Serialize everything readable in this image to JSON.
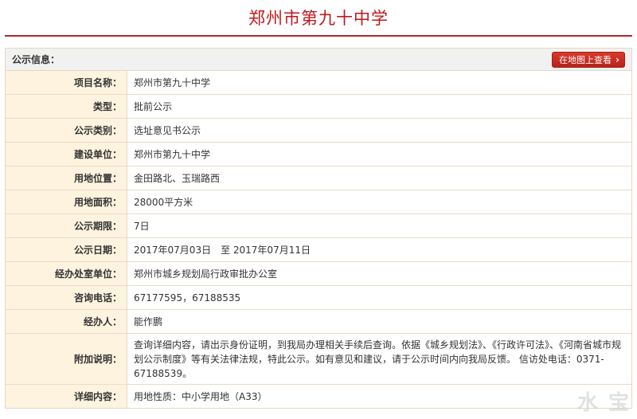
{
  "page": {
    "title": "郑州市第九十中学"
  },
  "panel": {
    "header_label": "公示信息：",
    "map_button": "在地图上查看",
    "map_button_icon": "chevron-right-icon"
  },
  "rows": [
    {
      "key": "项目名称：",
      "value": "郑州市第九十中学"
    },
    {
      "key": "类型：",
      "value": "批前公示"
    },
    {
      "key": "公示类别：",
      "value": "选址意见书公示"
    },
    {
      "key": "建设单位：",
      "value": "郑州市第九十中学"
    },
    {
      "key": "用地位置：",
      "value": "金田路北、玉瑞路西"
    },
    {
      "key": "用地面积：",
      "value": "28000平方米"
    },
    {
      "key": "公示期限：",
      "value": "7日"
    },
    {
      "key": "公示日期：",
      "value": "2017年07月03日　至 2017年07月11日"
    },
    {
      "key": "经办处室单位：",
      "value": "郑州市城乡规划局行政审批办公室"
    },
    {
      "key": "咨询电话：",
      "value": "67177595，67188535"
    },
    {
      "key": "经办人：",
      "value": "能作鹏"
    },
    {
      "key": "附加说明：",
      "value": "查询详细内容，请出示身份证明，到我局办理相关手续后查询。依据《城乡规划法》、《行政许可法》、《河南省城市规划公示制度》等有关法律法规，特此公示。如有意见和建议，请于公示时间内向我局反馈。 信访处电话：0371-67188539。"
    },
    {
      "key": "详细内容：",
      "value": "用地性质：中小学用地（A33）"
    }
  ],
  "watermark": "水 宝",
  "colors": {
    "accent": "#c0181d",
    "key_bg": "#fdf3df",
    "border": "#e8dcc6"
  }
}
